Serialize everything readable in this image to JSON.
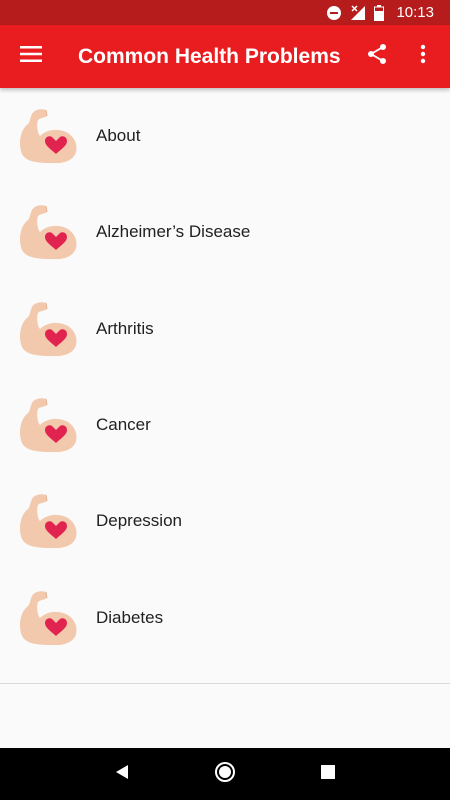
{
  "status_bar": {
    "time": "10:13",
    "icons": [
      "do-not-disturb-icon",
      "signal-icon",
      "battery-icon"
    ]
  },
  "app_bar": {
    "title": "Common Health Problems",
    "background": "#e91d1f",
    "icons": [
      "menu-icon",
      "share-icon",
      "more-vert-icon"
    ]
  },
  "list": {
    "items": [
      {
        "label": "About",
        "icon": "flexed-arm-heart-icon"
      },
      {
        "label": "Alzheimer’s Disease",
        "icon": "flexed-arm-heart-icon"
      },
      {
        "label": "Arthritis",
        "icon": "flexed-arm-heart-icon"
      },
      {
        "label": "Cancer",
        "icon": "flexed-arm-heart-icon"
      },
      {
        "label": "Depression",
        "icon": "flexed-arm-heart-icon"
      },
      {
        "label": "Diabetes",
        "icon": "flexed-arm-heart-icon"
      }
    ]
  },
  "nav_bar": {
    "icons": [
      "back-icon",
      "home-icon",
      "recents-icon"
    ]
  },
  "colors": {
    "status_bar": "#b71c1c",
    "app_bar": "#e91d1f",
    "arm": "#f2c9ad",
    "heart": "#e0244f"
  }
}
